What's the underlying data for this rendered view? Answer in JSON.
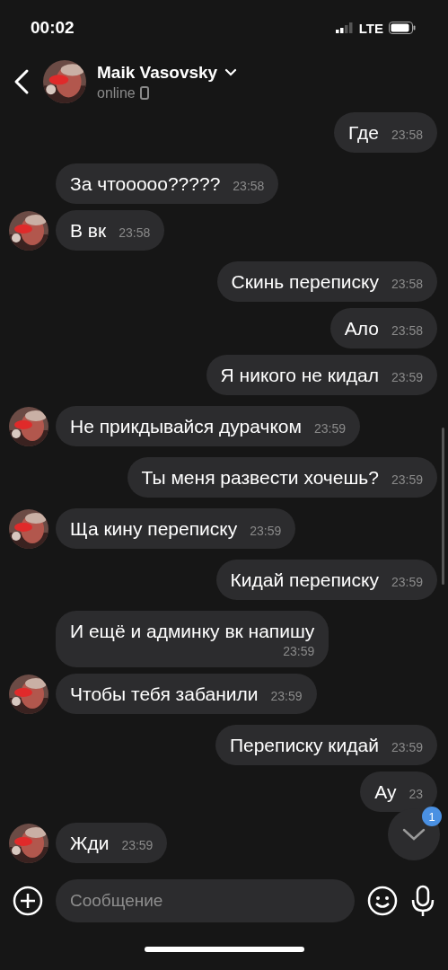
{
  "status_bar": {
    "time": "00:02",
    "network": "LTE"
  },
  "header": {
    "name": "Maik Vasovsky",
    "status": "online"
  },
  "messages": [
    {
      "outgoing": true,
      "avatar": false,
      "text": "Где",
      "time": "23:58"
    },
    {
      "outgoing": false,
      "avatar": false,
      "text": "За чтооооо?????",
      "time": "23:58"
    },
    {
      "outgoing": false,
      "avatar": true,
      "text": "В вк",
      "time": "23:58"
    },
    {
      "outgoing": true,
      "avatar": false,
      "text": "Скинь переписку",
      "time": "23:58"
    },
    {
      "outgoing": true,
      "avatar": false,
      "text": "Ало",
      "time": "23:58"
    },
    {
      "outgoing": true,
      "avatar": false,
      "text": "Я никого не кидал",
      "time": "23:59"
    },
    {
      "outgoing": false,
      "avatar": true,
      "text": "Не прикдывайся дурачком",
      "time": "23:59"
    },
    {
      "outgoing": true,
      "avatar": false,
      "text": "Ты меня развести хочешь?",
      "time": "23:59"
    },
    {
      "outgoing": false,
      "avatar": true,
      "text": "Ща кину переписку",
      "time": "23:59"
    },
    {
      "outgoing": true,
      "avatar": false,
      "text": "Кидай переписку",
      "time": "23:59"
    },
    {
      "outgoing": false,
      "avatar": false,
      "text": "И ещё и админку вк напишу",
      "time": "23:59",
      "wrapped": true
    },
    {
      "outgoing": false,
      "avatar": true,
      "text": "Чтобы тебя забанили",
      "time": "23:59"
    },
    {
      "outgoing": true,
      "avatar": false,
      "text": "Переписку кидай",
      "time": "23:59"
    },
    {
      "outgoing": true,
      "avatar": false,
      "text": "Ау",
      "time": "23"
    },
    {
      "outgoing": false,
      "avatar": true,
      "text": "Жди",
      "time": "23:59"
    }
  ],
  "scroll_button": {
    "badge": "1"
  },
  "composer": {
    "placeholder": "Сообщение"
  }
}
